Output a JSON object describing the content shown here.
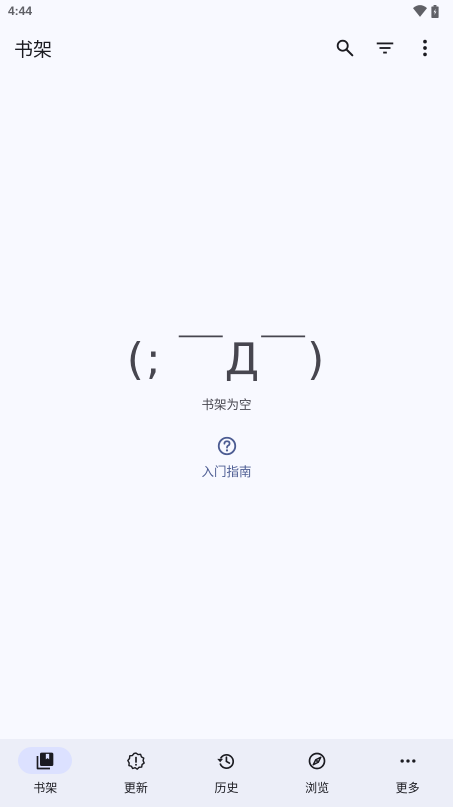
{
  "status_bar": {
    "time": "4:44",
    "icons": [
      "wifi-icon",
      "battery-icon"
    ]
  },
  "app_bar": {
    "title": "书架",
    "actions": [
      "search-icon",
      "filter-icon",
      "more-vert-icon"
    ]
  },
  "empty_state": {
    "kaomoji": "(; ￣Д￣)",
    "message": "书架为空"
  },
  "guide": {
    "label": "入门指南",
    "icon": "help-circle-icon"
  },
  "bottom_nav": {
    "items": [
      {
        "label": "书架",
        "icon": "library-icon",
        "active": true
      },
      {
        "label": "更新",
        "icon": "update-alert-icon",
        "active": false
      },
      {
        "label": "历史",
        "icon": "history-icon",
        "active": false
      },
      {
        "label": "浏览",
        "icon": "compass-icon",
        "active": false
      },
      {
        "label": "更多",
        "icon": "more-horiz-icon",
        "active": false
      }
    ]
  },
  "colors": {
    "background": "#f8f9ff",
    "accent": "#4c5c92",
    "nav_background": "#eceef8",
    "active_pill": "#dce1ff",
    "text": "#1b1b21"
  }
}
